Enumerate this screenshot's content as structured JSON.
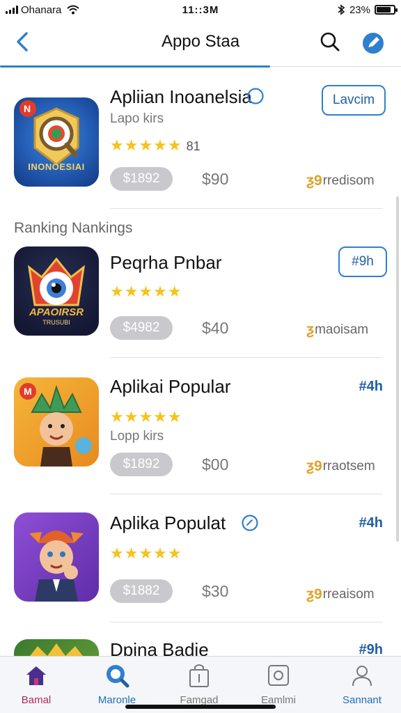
{
  "status_bar": {
    "carrier": "Ohanara",
    "time": "11::3M",
    "battery": "23%",
    "battery_level": 0.85
  },
  "header": {
    "title": "Appo Staa"
  },
  "apps": [
    {
      "name": "Apliian Inoanelsia",
      "subtitle": "Lapo kirs",
      "stars": "★★★★★",
      "rating_count": "81",
      "price_pill": "$1892",
      "price": "$90",
      "recommend": "rredisom",
      "recommend_glyph": "ƺ9",
      "action": "Lavcim",
      "icon_text": "INONOESIAI",
      "icon_badge": "N"
    },
    {
      "name": "Peqrha Pnbar",
      "stars": "★★★★★",
      "price_pill": "$4982",
      "price": "$40",
      "recommend": "maoisam",
      "recommend_glyph": "ƺ",
      "action": "#9h",
      "icon_text": "APAOIRSR",
      "icon_subtext": "TRUSUBI"
    },
    {
      "name": "Aplikai Popular",
      "subtitle": "Lopp kirs",
      "stars": "★★★★★",
      "price_pill": "$1892",
      "price": "$00",
      "recommend": "rraotsem",
      "recommend_glyph": "ƺ9",
      "size": "#4h",
      "icon_badge": "M"
    },
    {
      "name": "Aplika Populat",
      "stars": "★★★★★",
      "price_pill": "$1882",
      "price": "$30",
      "recommend": "rreaisom",
      "recommend_glyph": "ƺ9",
      "size": "#4h"
    },
    {
      "name": "Dpina Badie",
      "size": "#9h"
    }
  ],
  "section_label": "Ranking Nankings",
  "bottom_nav": [
    {
      "label": "Bamal",
      "icon": "home-icon"
    },
    {
      "label": "Maronle",
      "icon": "search-icon"
    },
    {
      "label": "Famgad",
      "icon": "bag-icon"
    },
    {
      "label": "Eamlmi",
      "icon": "camera-icon"
    },
    {
      "label": "Sannant",
      "icon": "person-icon"
    }
  ],
  "colors": {
    "accent": "#2f7fcf",
    "link": "#1f5fa6",
    "star": "#f6c21c",
    "home_active": "#4a2d8f",
    "price_pill": "#c9c9cd"
  }
}
